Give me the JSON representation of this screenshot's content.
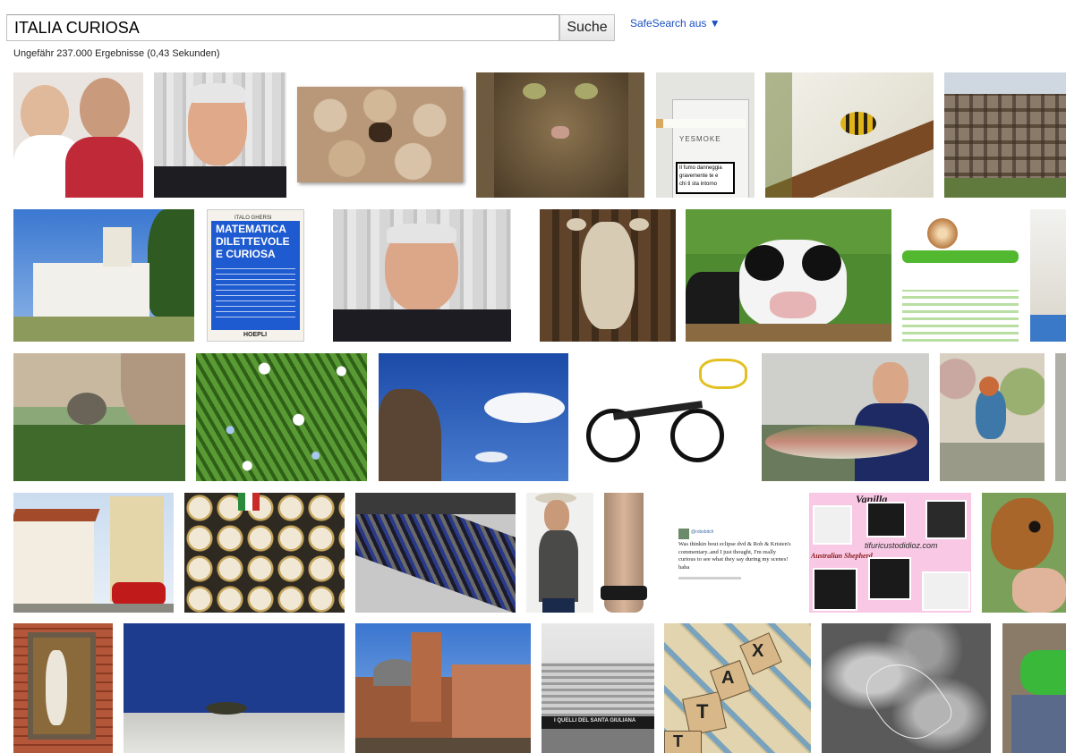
{
  "search": {
    "query": "ITALIA CURIOSA",
    "button_label": "Suche",
    "safesearch_label": "SafeSearch aus ▼"
  },
  "result_stats": "Ungefähr 237.000 Ergebnisse (0,43 Sekunden)",
  "thumbnails": {
    "book": {
      "author": "ITALO GHERSI",
      "title_lines": [
        "MATEMATICA",
        "DILETTEVOLE",
        "E CURIOSA"
      ],
      "publisher": "HOEPLI"
    },
    "cigarette": {
      "brand": "YESMOKE",
      "warning_lines": [
        "Il fumo danneggia",
        "gravemente te e",
        "chi ti sta intorno"
      ]
    },
    "tweet": {
      "handle": "@robsbitch",
      "text": "Was thinkin bout eclipse dvd & Rob & Kristen's commentary..and I just thought, I'm really curious to see what they say during my scenes! haha"
    },
    "puppies": {
      "title": "Vanilla",
      "site": "tifuricustodidioz.com",
      "subtitle": "Australian Shepherd"
    },
    "scrabble": {
      "letters": [
        "T",
        "A",
        "X",
        "T"
      ]
    },
    "stadium": {
      "banner": "I QUELLI DEL SANTA GIULIANA"
    }
  }
}
